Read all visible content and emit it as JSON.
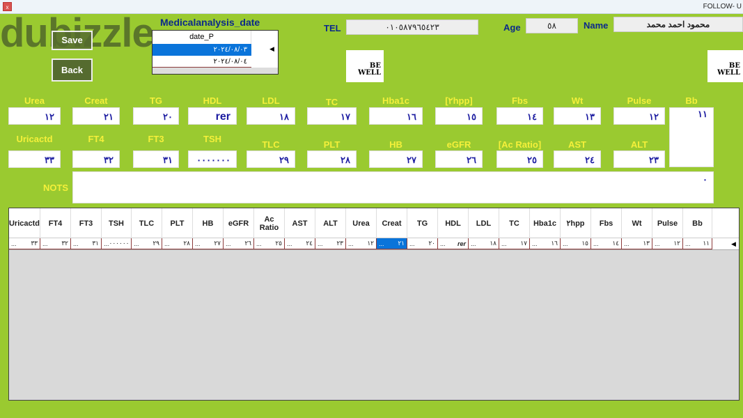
{
  "window": {
    "title": "FOLLOW- U",
    "close": "x"
  },
  "watermark": "dubizzle",
  "buttons": {
    "save": "Save",
    "back": "Back"
  },
  "dates": {
    "title": "Medicalanalysis_date",
    "column": "date_P",
    "rows": [
      "٢٠٢٤/٠٨/٠٣",
      "٢٠٢٤/٠٨/٠٤"
    ],
    "selected_index": 0
  },
  "patient": {
    "tel_label": "TEL",
    "tel": "٠١٠٥٨٧٩٦٥٤٢٣",
    "age_label": "Age",
    "age": "٥٨",
    "name_label": "Name",
    "name": "محمود احمد محمد"
  },
  "logo": "BE WELL",
  "fields_row1": [
    {
      "label": "Urea",
      "value": "١٢"
    },
    {
      "label": "Creat",
      "value": "٢١"
    },
    {
      "label": "TG",
      "value": "٢٠"
    },
    {
      "label": "HDL",
      "value": "rer"
    },
    {
      "label": "LDL",
      "value": "١٨"
    },
    {
      "label": "TC",
      "value": "١٧"
    },
    {
      "label": "Hba1c",
      "value": "١٦"
    },
    {
      "label": "[٢hpp]",
      "value": "١٥"
    },
    {
      "label": "Fbs",
      "value": "١٤"
    },
    {
      "label": "Wt",
      "value": "١٣"
    },
    {
      "label": "Pulse",
      "value": "١٢"
    },
    {
      "label": "Bb",
      "value": "١١"
    }
  ],
  "fields_row2": [
    {
      "label": "Uricactd",
      "value": "٣٣"
    },
    {
      "label": "FT4",
      "value": "٣٢"
    },
    {
      "label": "FT3",
      "value": "٣١"
    },
    {
      "label": "TSH",
      "value": "٠٠٠٠٠٠٠"
    },
    {
      "label": "TLC",
      "value": "٢٩"
    },
    {
      "label": "PLT",
      "value": "٢٨"
    },
    {
      "label": "HB",
      "value": "٢٧"
    },
    {
      "label": "eGFR",
      "value": "٢٦"
    },
    {
      "label": "[Ac Ratio]",
      "value": "٢٥"
    },
    {
      "label": "AST",
      "value": "٢٤"
    },
    {
      "label": "ALT",
      "value": "٢٣"
    }
  ],
  "notes": {
    "label": "NOTS",
    "value": "٠"
  },
  "grid": {
    "columns": [
      "Uricactd",
      "FT4",
      "FT3",
      "TSH",
      "TLC",
      "PLT",
      "HB",
      "eGFR",
      "Ac Ratio",
      "AST",
      "ALT",
      "Urea",
      "Creat",
      "TG",
      "HDL",
      "LDL",
      "TC",
      "Hba1c",
      "٢hpp",
      "Fbs",
      "Wt",
      "Pulse",
      "Bb"
    ],
    "row": [
      "٣٣",
      "٣٢",
      "٣١",
      "٠٠٠٠٠٠",
      "٢٩",
      "٢٨",
      "٢٧",
      "٢٦",
      "٢٥",
      "٢٤",
      "٢٣",
      "١٢",
      "٢١",
      "٢٠",
      "rer",
      "١٨",
      "١٧",
      "١٦",
      "١٥",
      "١٤",
      "١٣",
      "١٢",
      "١١"
    ],
    "ellipsis": "...",
    "selected_column": "Creat"
  },
  "colors": {
    "background": "#9aca30",
    "label": "#f5f03a",
    "value": "#1a1aa0",
    "button": "#556b2f",
    "selection": "#0a74da"
  }
}
